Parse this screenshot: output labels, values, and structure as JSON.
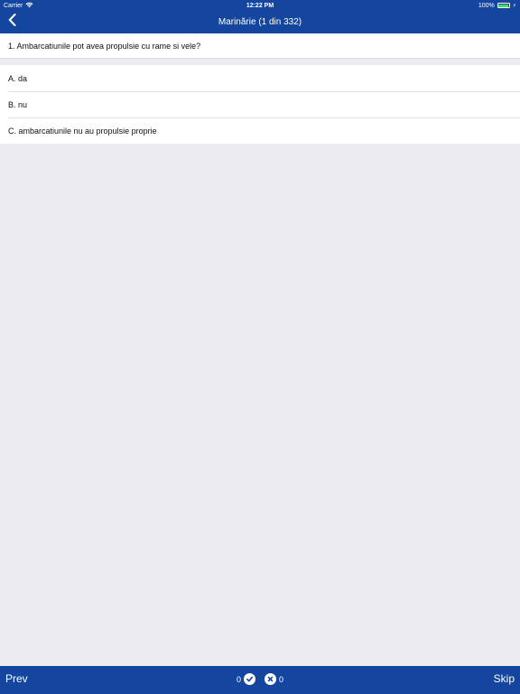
{
  "status_bar": {
    "carrier": "Carrier",
    "time": "12:22 PM",
    "battery_percent": "100%"
  },
  "nav": {
    "title": "Marinărie (1 din 332)",
    "back_icon": "chevron-left-icon"
  },
  "question": {
    "text": "1. Ambarcatiunile pot avea propulsie cu rame si vele?"
  },
  "answers": [
    {
      "label": "A. da"
    },
    {
      "label": "B. nu"
    },
    {
      "label": "C. ambarcatiunile nu au propulsie proprie"
    }
  ],
  "toolbar": {
    "prev_label": "Prev",
    "skip_label": "Skip",
    "correct_count": "0",
    "wrong_count": "0",
    "correct_icon": "checkmark-circle-icon",
    "wrong_icon": "x-circle-icon"
  },
  "colors": {
    "brand_blue": "#1446a0",
    "background": "#ebebf1",
    "battery_green": "#4cd964"
  }
}
